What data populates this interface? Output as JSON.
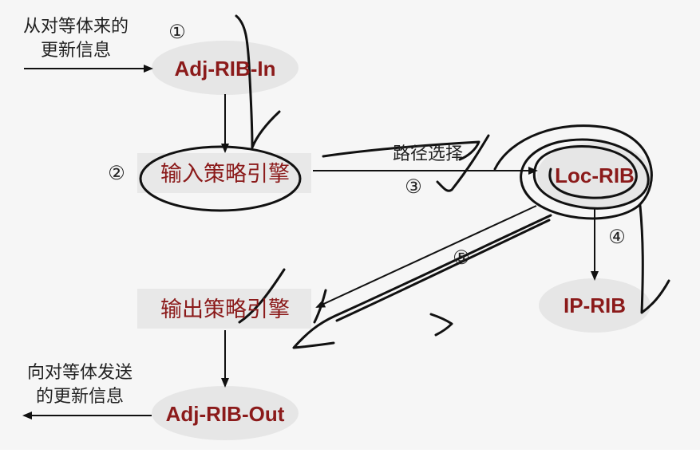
{
  "nodes": {
    "adj_rib_in": "Adj-RIB-In",
    "input_policy": "输入策略引擎",
    "loc_rib": "Loc-RIB",
    "ip_rib": "IP-RIB",
    "output_policy": "输出策略引擎",
    "adj_rib_out": "Adj-RIB-Out"
  },
  "labels": {
    "from_peer_line1": "从对等体来的",
    "from_peer_line2": "更新信息",
    "to_peer_line1": "向对等体发送",
    "to_peer_line2": "的更新信息",
    "route_selection": "路径选择"
  },
  "step_markers": {
    "step1": "①",
    "step2": "②",
    "step3": "③",
    "step4": "④",
    "step5": "⑤"
  },
  "colors": {
    "node_text": "#8b1a1a",
    "ellipse_fill": "#e6e6e6",
    "box_fill": "#e8e8e8",
    "ink": "#111111",
    "background": "#f6f6f6"
  }
}
